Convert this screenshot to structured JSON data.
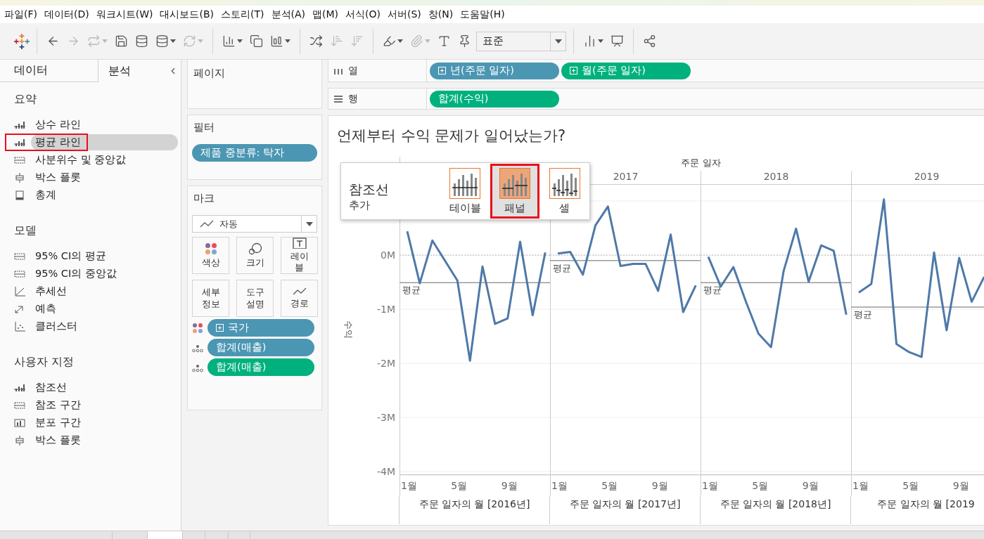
{
  "menu": [
    "파일(F)",
    "데이터(D)",
    "워크시트(W)",
    "대시보드(B)",
    "스토리(T)",
    "분석(A)",
    "맵(M)",
    "서식(O)",
    "서버(S)",
    "창(N)",
    "도움말(H)"
  ],
  "toolbar": [
    [
      {
        "kind": "logo"
      }
    ],
    [
      {
        "kind": "back",
        "disabled": false
      },
      {
        "kind": "forward",
        "disabled": true
      },
      {
        "kind": "redo",
        "disabled": true,
        "menu": true
      },
      {
        "kind": "save",
        "disabled": false
      },
      {
        "kind": "new_data_source",
        "disabled": false
      },
      {
        "kind": "pause",
        "disabled": false,
        "menu": true
      },
      {
        "kind": "refresh",
        "disabled": true,
        "menu": true
      }
    ],
    [
      {
        "kind": "new_sheet",
        "disabled": false,
        "menu": true
      },
      {
        "kind": "duplicate",
        "disabled": false
      },
      {
        "kind": "clear",
        "disabled": false,
        "menu": true
      }
    ],
    [
      {
        "kind": "swap",
        "disabled": false
      },
      {
        "kind": "sort_asc",
        "disabled": true
      },
      {
        "kind": "sort_desc",
        "disabled": true
      }
    ],
    [
      {
        "kind": "highlight",
        "disabled": false,
        "menu": true
      },
      {
        "kind": "annotate",
        "disabled": true,
        "menu": true
      },
      {
        "kind": "text",
        "disabled": false
      },
      {
        "kind": "pin",
        "disabled": false
      },
      {
        "kind": "select",
        "value": "표준"
      }
    ],
    [
      {
        "kind": "show_me",
        "disabled": false,
        "menu": true
      },
      {
        "kind": "presentation",
        "disabled": false
      }
    ],
    [
      {
        "kind": "share",
        "disabled": false
      }
    ]
  ],
  "side_tabs": [
    {
      "label": "데이터",
      "selected": false
    },
    {
      "label": "분석",
      "selected": true
    }
  ],
  "analytics": [
    {
      "title": "요약",
      "items": [
        {
          "label": "상수 라인",
          "kind": "line",
          "selected": false,
          "callout": false
        },
        {
          "label": "평균 라인",
          "kind": "line",
          "selected": true,
          "callout": true
        },
        {
          "label": "사분위수 및 중앙값",
          "kind": "band",
          "selected": false,
          "callout": false
        },
        {
          "label": "박스 플롯",
          "kind": "box",
          "selected": false,
          "callout": false
        },
        {
          "label": "총계",
          "kind": "totals",
          "selected": false,
          "callout": false
        }
      ]
    },
    {
      "title": "모델",
      "items": [
        {
          "label": "95% CI의 평균",
          "kind": "band",
          "selected": false,
          "callout": false
        },
        {
          "label": "95% CI의 중앙값",
          "kind": "band",
          "selected": false,
          "callout": false
        },
        {
          "label": "추세선",
          "kind": "trend",
          "selected": false,
          "callout": false
        },
        {
          "label": "예측",
          "kind": "forecast",
          "selected": false,
          "callout": false
        },
        {
          "label": "클러스터",
          "kind": "cluster",
          "selected": false,
          "callout": false
        }
      ]
    },
    {
      "title": "사용자 지정",
      "items": [
        {
          "label": "참조선",
          "kind": "line",
          "selected": false,
          "callout": false
        },
        {
          "label": "참조 구간",
          "kind": "band",
          "selected": false,
          "callout": false
        },
        {
          "label": "분포 구간",
          "kind": "distribution",
          "selected": false,
          "callout": false
        },
        {
          "label": "박스 플롯",
          "kind": "box",
          "selected": false,
          "callout": false
        }
      ]
    }
  ],
  "pages": {
    "title": "페이지"
  },
  "filters": {
    "title": "필터",
    "pills": [
      {
        "label": "제품 중분류: 탁자",
        "kind": "discrete"
      }
    ]
  },
  "marks": {
    "title": "마크",
    "mark_type": "자동",
    "buttons": [
      {
        "label": "색상",
        "kind": "color"
      },
      {
        "label": "크기",
        "kind": "size"
      },
      {
        "label": "레이블",
        "kind": "label"
      },
      {
        "label": "세부 정보",
        "kind": "detail"
      },
      {
        "label": "도구 설명",
        "kind": "tooltip"
      },
      {
        "label": "경로",
        "kind": "path"
      }
    ],
    "fields": [
      {
        "label": "국가",
        "kind": "color",
        "continuous": false,
        "expandable": true
      },
      {
        "label": "합계(매출)",
        "kind": "detail",
        "continuous": false,
        "expandable": false
      },
      {
        "label": "합계(매출)",
        "kind": "detail",
        "continuous": true,
        "expandable": false
      }
    ]
  },
  "shelves": [
    {
      "label": "열",
      "kind": "columns",
      "pills": [
        {
          "label": "년(주문 일자)",
          "kind": "discrete",
          "expandable": true
        },
        {
          "label": "월(주문 일자)",
          "kind": "continuous",
          "expandable": true
        }
      ]
    },
    {
      "label": "행",
      "kind": "rows",
      "pills": [
        {
          "label": "합계(수익)",
          "kind": "continuous",
          "expandable": false
        }
      ]
    }
  ],
  "view": {
    "title": "언제부터 수익 문제가 일어났는가?",
    "column_header": "주문 일자",
    "panels": [
      {
        "axis_title": "주문 일자의 월 [2016년]",
        "chart_data": {
          "type": "line",
          "ylabel": "수익",
          "grid": true,
          "x": [
            1,
            2,
            3,
            4,
            5,
            6,
            7,
            8,
            9,
            10,
            11,
            12
          ],
          "xlim": [
            0.383,
            12.383
          ],
          "ylim": [
            -4.06,
            1.3
          ],
          "xticks": [
            {
              "value": 1,
              "label": "1월"
            },
            {
              "value": 5,
              "label": "5월"
            },
            {
              "value": 9,
              "label": "9월"
            }
          ],
          "yticks": [
            {
              "value": 0,
              "label": "0M"
            },
            {
              "value": -1,
              "label": "-1M"
            },
            {
              "value": -2,
              "label": "-2M"
            },
            {
              "value": -3,
              "label": "-3M"
            },
            {
              "value": -4,
              "label": "-4M"
            }
          ],
          "series": [
            {
              "color": "#4e79a7",
              "values": [
                0.44,
                -0.52,
                0.27,
                -0.1,
                -0.47,
                -1.95,
                -0.21,
                -1.27,
                -1.17,
                0.25,
                -1.11,
                0.05
              ]
            }
          ],
          "ref_lines": [
            {
              "axis": "y",
              "value": 0
            },
            {
              "axis": "y",
              "value": -0.51,
              "label": "평균"
            }
          ]
        }
      },
      {
        "header": "2017",
        "axis_title": "주문 일자의 월 [2017년]",
        "chart_data": {
          "type": "line",
          "grid": true,
          "x": [
            1,
            2,
            3,
            4,
            5,
            6,
            7,
            8,
            9,
            10,
            11,
            12
          ],
          "xlim": [
            0.383,
            12.383
          ],
          "ylim": [
            -4.06,
            1.3
          ],
          "xticks": [
            {
              "value": 1,
              "label": "1월"
            },
            {
              "value": 5,
              "label": "5월"
            },
            {
              "value": 9,
              "label": "9월"
            }
          ],
          "series": [
            {
              "color": "#4e79a7",
              "values": [
                0.03,
                0.06,
                -0.36,
                0.55,
                0.9,
                -0.2,
                -0.16,
                -0.16,
                -0.66,
                0.38,
                -1.05,
                -0.56
              ]
            }
          ],
          "ref_lines": [
            {
              "axis": "y",
              "value": 0
            },
            {
              "axis": "y",
              "value": -0.1,
              "label": "평균"
            }
          ]
        }
      },
      {
        "header": "2018",
        "axis_title": "주문 일자의 월 [2018년]",
        "chart_data": {
          "type": "line",
          "grid": true,
          "x": [
            1,
            2,
            3,
            4,
            5,
            6,
            7,
            8,
            9,
            10,
            11,
            12
          ],
          "xlim": [
            0.383,
            12.383
          ],
          "ylim": [
            -4.06,
            1.3
          ],
          "xticks": [
            {
              "value": 1,
              "label": "1월"
            },
            {
              "value": 5,
              "label": "5월"
            },
            {
              "value": 9,
              "label": "9월"
            }
          ],
          "series": [
            {
              "color": "#4e79a7",
              "values": [
                -0.03,
                -0.58,
                -0.22,
                -0.86,
                -1.45,
                -1.7,
                -0.3,
                0.49,
                -0.49,
                0.18,
                0.08,
                -1.1
              ]
            }
          ],
          "ref_lines": [
            {
              "axis": "y",
              "value": 0
            },
            {
              "axis": "y",
              "value": -0.51,
              "label": "평균"
            }
          ]
        }
      },
      {
        "header": "2019",
        "axis_title": "주문 일자의 월 [2019",
        "chart_data": {
          "type": "line",
          "grid": true,
          "x": [
            1,
            2,
            3,
            4,
            5,
            6,
            7,
            8,
            9,
            10,
            11
          ],
          "xlim": [
            0.383,
            12.383
          ],
          "ylim": [
            -4.06,
            1.3
          ],
          "xticks": [
            {
              "value": 1,
              "label": "1월"
            },
            {
              "value": 5,
              "label": "5월"
            },
            {
              "value": 9,
              "label": "9월"
            }
          ],
          "series": [
            {
              "color": "#4e79a7",
              "values": [
                -0.69,
                -0.53,
                1.03,
                -1.64,
                -1.79,
                -1.88,
                0.05,
                -1.39,
                -0.05,
                -0.86,
                -0.4
              ]
            }
          ],
          "ref_lines": [
            {
              "axis": "y",
              "value": 0
            },
            {
              "axis": "y",
              "value": -0.96,
              "label": "평균"
            }
          ]
        }
      }
    ],
    "popup": {
      "title": "참조선",
      "subtitle": "추가",
      "options": [
        {
          "label": "테이블",
          "kind": "table",
          "selected": false,
          "callout": false
        },
        {
          "label": "패널",
          "kind": "pane",
          "selected": true,
          "callout": true
        },
        {
          "label": "셀",
          "kind": "cell",
          "selected": false,
          "callout": false
        }
      ]
    }
  },
  "sheet_tabs": [
    {
      "selected": false
    },
    {
      "selected": false
    },
    {
      "selected": true
    },
    {
      "selected": false
    },
    {
      "selected": false
    },
    {
      "selected": false
    }
  ]
}
